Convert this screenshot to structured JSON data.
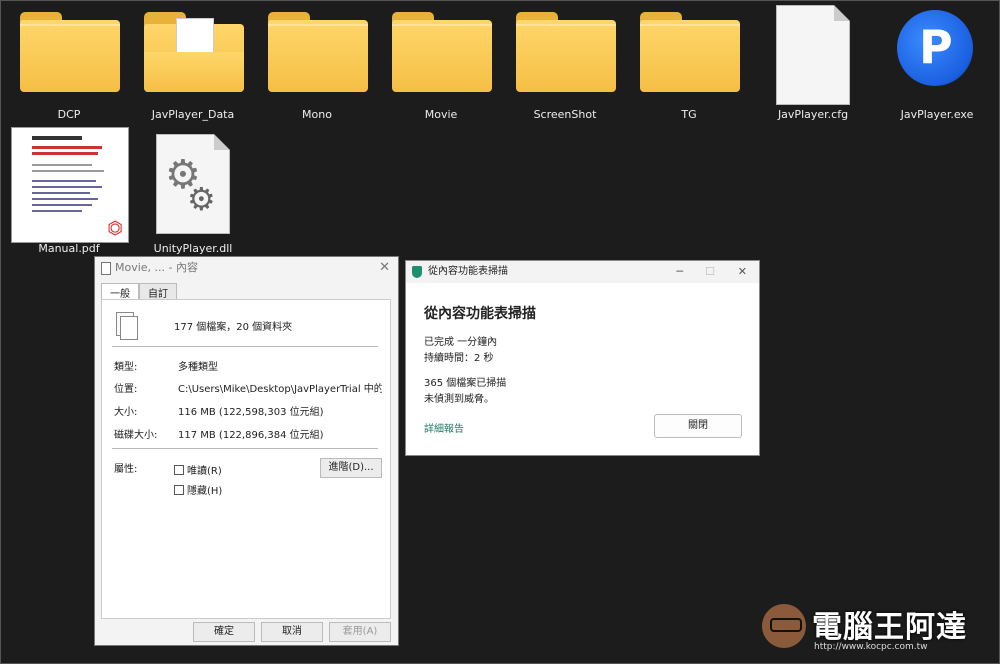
{
  "desktop": {
    "icons": [
      {
        "label": "DCP"
      },
      {
        "label": "JavPlayer_Data"
      },
      {
        "label": "Mono"
      },
      {
        "label": "Movie"
      },
      {
        "label": "ScreenShot"
      },
      {
        "label": "TG"
      },
      {
        "label": "JavPlayer.cfg"
      },
      {
        "label": "JavPlayer.exe"
      },
      {
        "label": "Manual.pdf"
      },
      {
        "label": "UnityPlayer.dll"
      }
    ]
  },
  "properties": {
    "title": "Movie, ... - 內容",
    "tabs": [
      "一般",
      "自訂"
    ],
    "summary": "177 個檔案，20 個資料夾",
    "rows": [
      {
        "key": "類型:",
        "value": "多種類型"
      },
      {
        "key": "位置:",
        "value": "C:\\Users\\Mike\\Desktop\\JavPlayerTrial 中的所有項目"
      },
      {
        "key": "大小:",
        "value": "116 MB (122,598,303 位元組)"
      },
      {
        "key": "磁碟大小:",
        "value": "117 MB (122,896,384 位元組)"
      }
    ],
    "attributes_label": "屬性:",
    "readonly_label": "唯讀(R)",
    "hidden_label": "隱藏(H)",
    "advanced_button": "進階(D)...",
    "ok_button": "確定",
    "cancel_button": "取消",
    "apply_button": "套用(A)"
  },
  "scan": {
    "title": "從內容功能表掃描",
    "heading": "從內容功能表掃描",
    "line1": "已完成 一分鐘內",
    "line2": "持續時間：2 秒",
    "line3": "365 個檔案已掃描",
    "line4": "未偵測到威脅。",
    "details_link": "詳細報告",
    "close_button": "關閉",
    "minimize": "─",
    "maximize": "☐",
    "close": "✕"
  },
  "watermark": {
    "brand": "電腦王阿達",
    "url": "http://www.kocpc.com.tw"
  },
  "colors": {
    "folder": "#f5bf45",
    "accent_green": "#1e8f6e",
    "exe_blue": "#1a5fe0"
  }
}
